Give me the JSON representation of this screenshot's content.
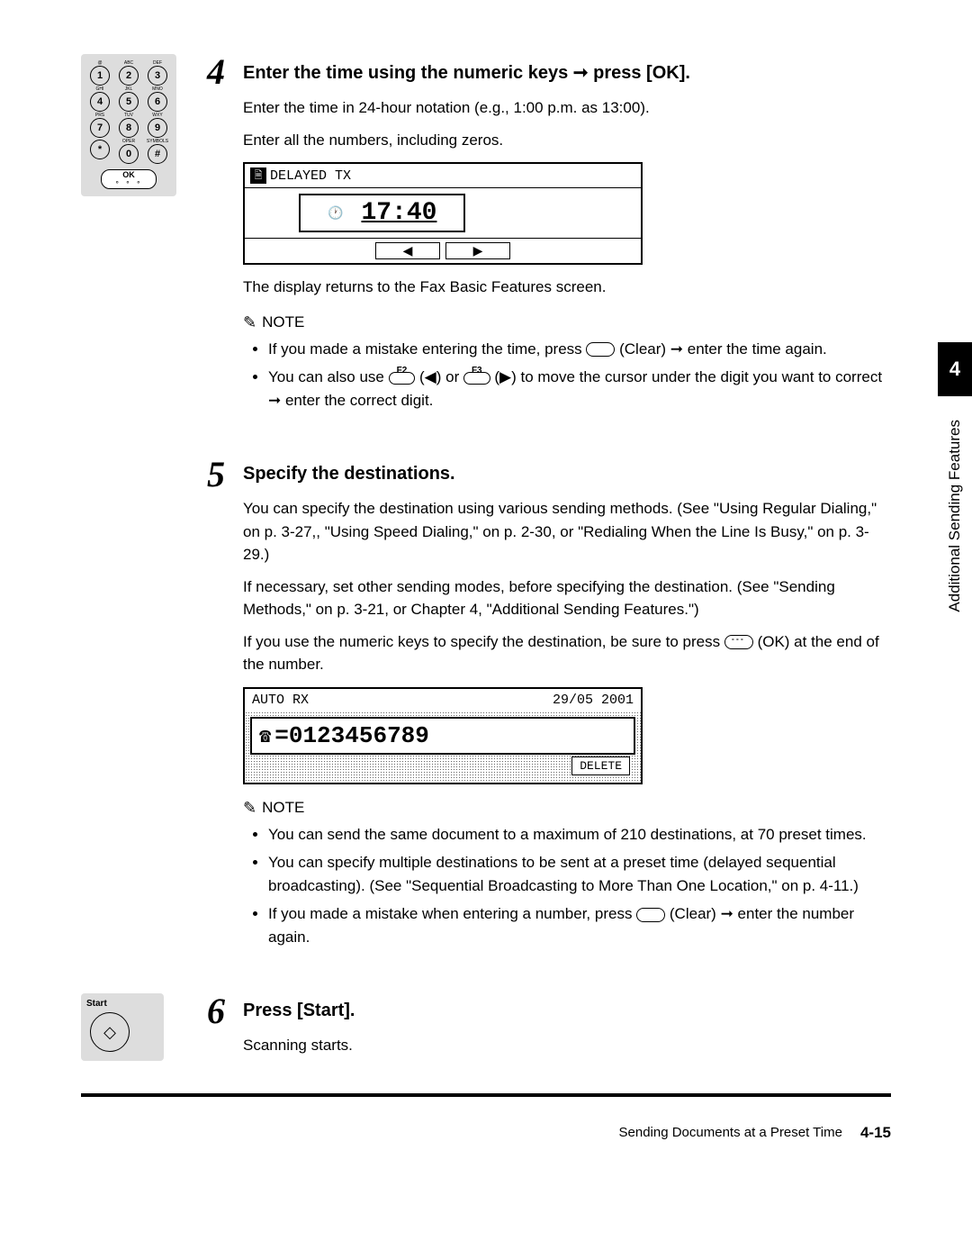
{
  "keypad": {
    "rows": [
      [
        {
          "l": "@",
          "n": "1"
        },
        {
          "l": "ABC",
          "n": "2"
        },
        {
          "l": "DEF",
          "n": "3"
        }
      ],
      [
        {
          "l": "GHI",
          "n": "4"
        },
        {
          "l": "JKL",
          "n": "5"
        },
        {
          "l": "MNO",
          "n": "6"
        }
      ],
      [
        {
          "l": "PRS",
          "n": "7"
        },
        {
          "l": "TUV",
          "n": "8"
        },
        {
          "l": "WXY",
          "n": "9"
        }
      ],
      [
        {
          "l": "",
          "n": "*"
        },
        {
          "l": "OPER",
          "n": "0"
        },
        {
          "l": "SYMBOLS",
          "n": "#"
        }
      ]
    ],
    "ok": "OK"
  },
  "step4": {
    "num": "4",
    "heading_a": "Enter the time using the numeric keys ",
    "heading_b": " press [OK].",
    "body1": "Enter the time in 24-hour notation (e.g., 1:00 p.m. as 13:00).",
    "body2": "Enter all the numbers, including zeros.",
    "lcd_title": "DELAYED TX",
    "lcd_time": "17:40",
    "arrow_l": "◀",
    "arrow_r": "▶",
    "body3": "The display returns to the Fax Basic Features screen.",
    "note_label": "NOTE",
    "note1_a": "If you made a mistake entering the time, press ",
    "note1_b": " (Clear) ",
    "note1_c": " enter the time again.",
    "note2_a": "You can also use ",
    "f2": "F2",
    "note2_b": " (◀) or ",
    "f3": "F3",
    "note2_c": " (▶) to move the cursor under the digit you want to correct ",
    "note2_d": " enter the correct digit."
  },
  "step5": {
    "num": "5",
    "heading": "Specify the destinations.",
    "body1": "You can specify the destination using various sending methods. (See \"Using Regular Dialing,\" on p. 3-27,, \"Using Speed Dialing,\" on p. 2-30, or \"Redialing When the Line Is Busy,\" on p. 3-29.)",
    "body2": "If necessary, set other sending modes, before specifying the destination. (See \"Sending Methods,\" on p. 3-21, or Chapter 4, \"Additional Sending Features.\")",
    "body3_a": "If you use the numeric keys to specify the destination, be sure to press ",
    "body3_b": " (OK) at the end of the number.",
    "lcd_mode": "AUTO RX",
    "lcd_date": "29/05 2001",
    "lcd_number": "=0123456789",
    "delete": "DELETE",
    "note_label": "NOTE",
    "note1": "You can send the same document to a maximum of 210 destinations, at 70 preset times.",
    "note2": "You can specify multiple destinations to be sent at a preset time (delayed sequential broadcasting). (See \"Sequential Broadcasting to More Than One Location,\" on p. 4-11.)",
    "note3_a": "If you made a mistake when entering a number, press ",
    "note3_b": " (Clear) ",
    "note3_c": " enter the number again."
  },
  "step6": {
    "num": "6",
    "start_key": "Start",
    "heading": "Press [Start].",
    "body": "Scanning starts."
  },
  "sidebar": {
    "num": "4",
    "text": "Additional Sending Features"
  },
  "footer": {
    "title": "Sending Documents at a Preset Time",
    "page": "4-15"
  },
  "arrow": "➞"
}
